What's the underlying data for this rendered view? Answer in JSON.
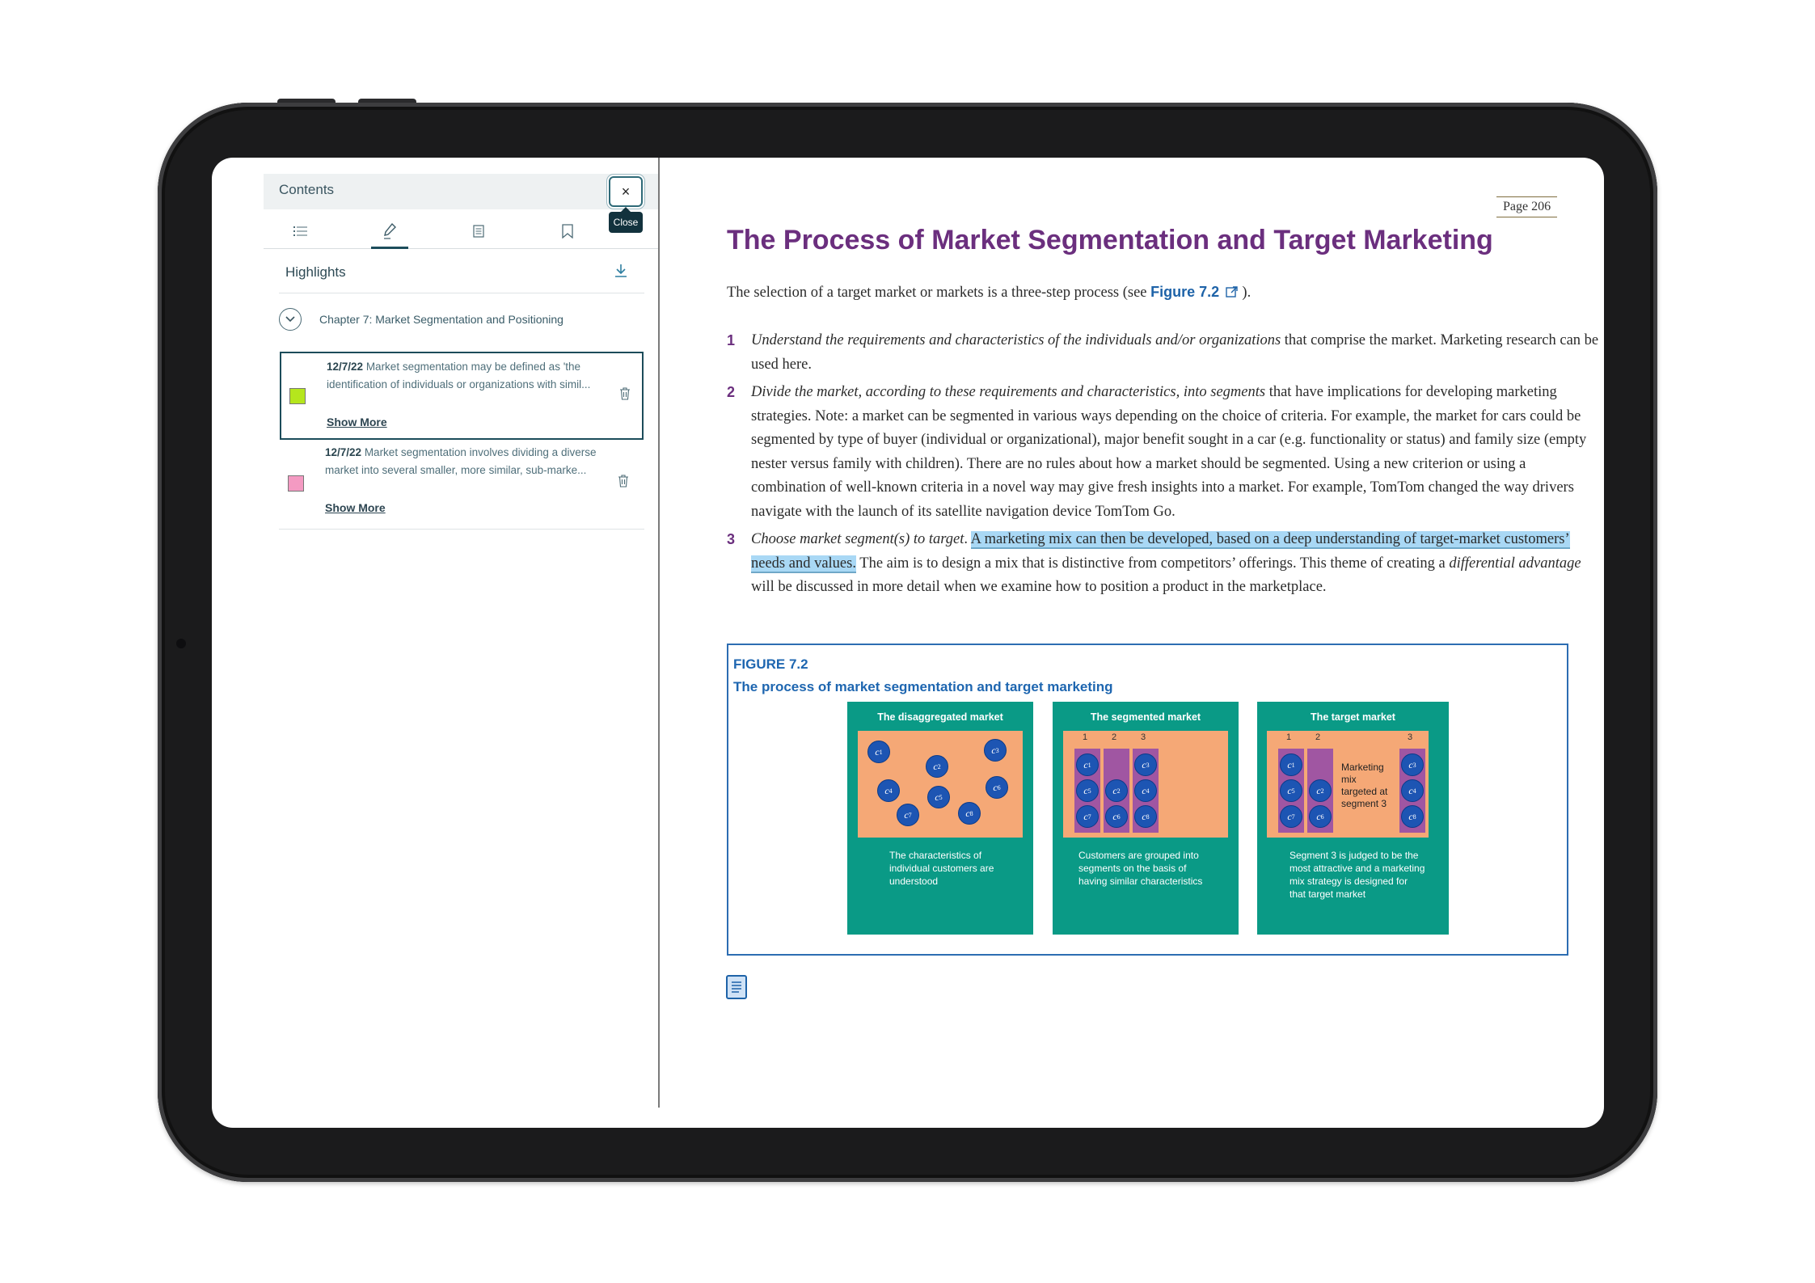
{
  "sidebar": {
    "header": "Contents",
    "close_label": "×",
    "tooltip": "Close",
    "tabs": [
      {
        "name": "list-icon"
      },
      {
        "name": "highlighter-icon"
      },
      {
        "name": "notes-icon"
      },
      {
        "name": "bookmark-icon"
      }
    ],
    "highlights_title": "Highlights",
    "chapter": "Chapter 7: Market Segmentation and Positioning",
    "items": [
      {
        "date": "12/7/22",
        "text": "Market segmentation may be defined as 'the identification of individuals or organizations with simil...",
        "color": "#b5e61d",
        "show_more": "Show More"
      },
      {
        "date": "12/7/22",
        "text": "Market segmentation involves dividing a diverse market into several smaller, more similar, sub-marke...",
        "color": "#f49ac2",
        "show_more": "Show More"
      }
    ]
  },
  "main": {
    "page": "Page 206",
    "title": "The Process of Market Segmentation and Target Marketing",
    "intro_before": "The selection of a target market or markets is a three-step process (see ",
    "intro_link": "Figure 7.2",
    "intro_after": " ).",
    "list": [
      {
        "num": "1",
        "italic": "Understand the requirements and characteristics of the individuals and/or organizations",
        "rest": " that comprise the market. Marketing research can be used here."
      },
      {
        "num": "2",
        "italic": "Divide the market, according to these requirements and characteristics, into segments",
        "rest": " that have implications for developing marketing strategies. Note: a market can be segmented in various ways depending on the choice of criteria. For example, the market for cars could be segmented by type of buyer (individual or organizational), major benefit sought in a car (e.g. functionality or status) and family size (empty nester versus family with children). There are no rules about how a market should be segmented. Using a new criterion or using a combination of well-known criteria in a novel way may give fresh insights into a market. For example, TomTom changed the way drivers navigate with the launch of its satellite navigation device TomTom Go."
      },
      {
        "num": "3",
        "italic": "Choose market segment(s) to target",
        "dot": ". ",
        "highlight": "A marketing mix can then be developed, based on a deep understanding of target-market customers’ needs and values.",
        "rest_a": " The aim is to design a mix that is distinctive from competitors’ offerings. This theme of creating a ",
        "italic2": "differential advantage",
        "rest_b": " will be discussed in more detail when we examine how to position a product in the marketplace."
      }
    ],
    "figure": {
      "label": "FIGURE 7.2",
      "title": "The process of market segmentation and target marketing",
      "panels": [
        {
          "title": "The disaggregated market",
          "caption": "The characteristics of individual customers are understood"
        },
        {
          "title": "The segmented market",
          "caption": "Customers are grouped into segments on the basis of having similar characteristics"
        },
        {
          "title": "The target market",
          "caption": "Segment 3 is judged to be the most attractive and a marketing mix strategy is designed for that target market"
        }
      ],
      "segment_numbers": [
        "1",
        "2",
        "3"
      ],
      "mix_text": "Marketing mix targeted at segment 3",
      "customer_letter": "c",
      "customers": [
        "1",
        "2",
        "3",
        "4",
        "5",
        "6",
        "7",
        "8"
      ]
    }
  }
}
